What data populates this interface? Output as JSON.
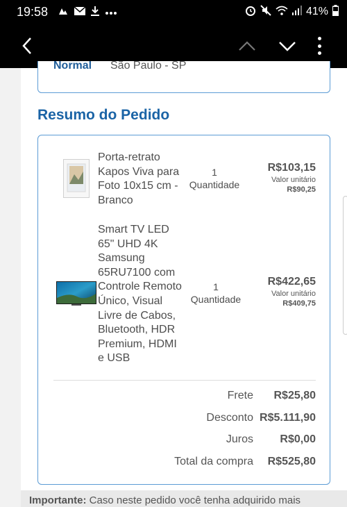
{
  "status_bar": {
    "time": "19:58",
    "battery": "41%",
    "left_icons": [
      "notification-icon",
      "mail-icon",
      "download-icon",
      "more-notifications-icon"
    ],
    "right_icons": [
      "alarm-icon",
      "mute-icon",
      "wifi-icon",
      "signal-icon",
      "battery-icon"
    ]
  },
  "app_bar": {
    "icons": [
      "back-arrow-icon",
      "chevron-up-icon",
      "chevron-down-icon",
      "more-vertical-icon"
    ]
  },
  "previous_section": {
    "shipping_type": "Normal",
    "city": "São Paulo - SP"
  },
  "order_summary": {
    "title": "Resumo do Pedido",
    "items": [
      {
        "name_lines": [
          "Porta-retrato",
          "Kapos Viva para",
          "Foto 10x15 cm -",
          "Branco"
        ],
        "quantity": "1",
        "quantity_label": "Quantidade",
        "price": "R$103,15",
        "unit_label": "Valor unitário",
        "unit_value": "R$90,25"
      },
      {
        "name_lines": [
          "Smart TV LED",
          "65\" UHD 4K",
          "Samsung",
          "65RU7100 com",
          "Controle Remoto",
          "Único, Visual",
          "Livre de Cabos,",
          "Bluetooth, HDR",
          "Premium, HDMI",
          "e USB"
        ],
        "quantity": "1",
        "quantity_label": "Quantidade",
        "price": "R$422,65",
        "unit_label": "Valor unitário",
        "unit_value": "R$409,75"
      }
    ],
    "totals": [
      {
        "label": "Frete",
        "value": "R$25,80"
      },
      {
        "label": "Desconto",
        "value": "R$5.111,90"
      },
      {
        "label": "Juros",
        "value": "R$0,00"
      },
      {
        "label": "Total da compra",
        "value": "R$525,80"
      }
    ]
  },
  "notice": {
    "label": "Importante:",
    "text": " Caso neste pedido você tenha adquirido mais"
  },
  "colors": {
    "accent": "#1b64a6",
    "card_border": "#5b9bd5",
    "app_bar": "#000000"
  }
}
